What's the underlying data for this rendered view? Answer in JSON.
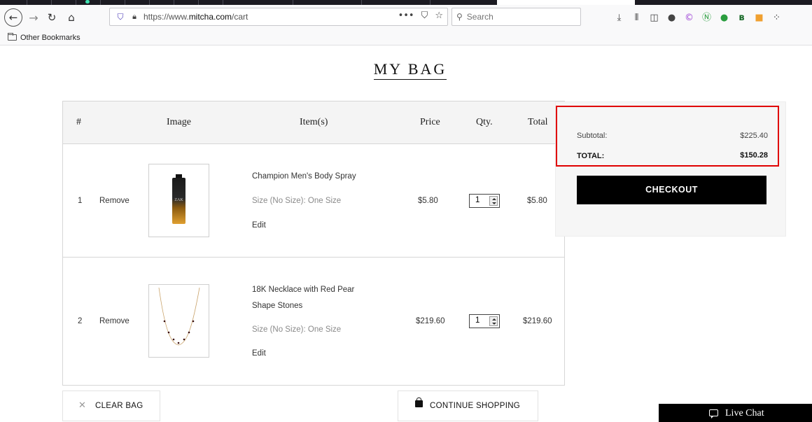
{
  "browser": {
    "url_prefix": "https://www.",
    "url_domain": "mitcha.com",
    "url_path": "/cart",
    "url_actions": [
      "•••",
      "⛉",
      "☆"
    ],
    "search_placeholder": "Search",
    "bookmarks_folder": "Other Bookmarks",
    "toolbar_icons": [
      "download-icon",
      "library-icon",
      "sidebar-icon",
      "account-icon",
      "extension-c-icon",
      "extension-n-icon",
      "extension-chat-icon",
      "extension-bw-icon",
      "extension-orange-icon",
      "extension-grid-icon"
    ]
  },
  "page": {
    "title": "MY BAG"
  },
  "table": {
    "headers": {
      "num": "#",
      "image": "Image",
      "items": "Item(s)",
      "price": "Price",
      "qty": "Qty.",
      "total": "Total"
    },
    "rows": [
      {
        "num": "1",
        "remove": "Remove",
        "name_line1": "Champion Men's Body Spray",
        "name_line2": "",
        "size": "Size (No Size): One Size",
        "edit": "Edit",
        "price": "$5.80",
        "qty": "1",
        "total": "$5.80",
        "thumb_label": "ZAK"
      },
      {
        "num": "2",
        "remove": "Remove",
        "name_line1": "18K Necklace with Red Pear",
        "name_line2": "Shape Stones",
        "size": "Size (No Size): One Size",
        "edit": "Edit",
        "price": "$219.60",
        "qty": "1",
        "total": "$219.60"
      }
    ]
  },
  "summary": {
    "subtotal_label": "Subtotal:",
    "subtotal_value": "$225.40",
    "total_label": "TOTAL:",
    "total_value": "$150.28",
    "checkout_label": "CHECKOUT",
    "highlight_color": "#e00000"
  },
  "footer": {
    "clear_bag": "CLEAR BAG",
    "continue_shopping": "CONTINUE SHOPPING",
    "live_chat": "Live Chat"
  }
}
